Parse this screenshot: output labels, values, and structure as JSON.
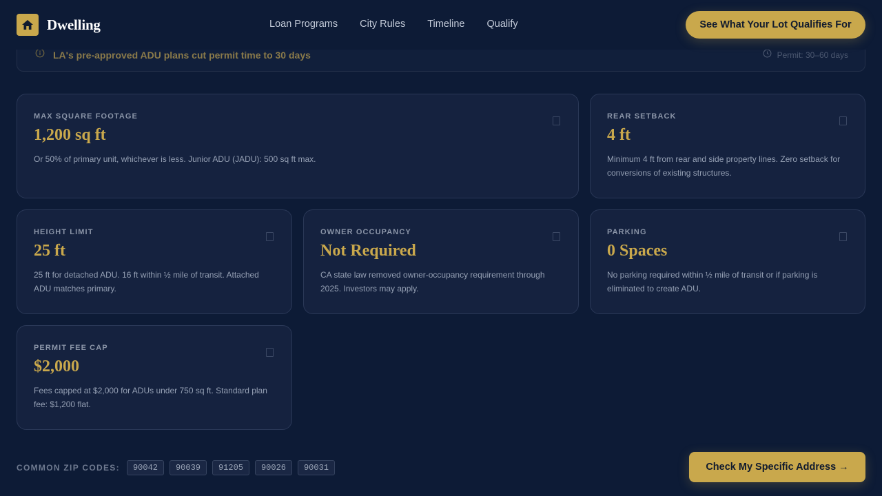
{
  "brand": {
    "name": "Dwelling",
    "logo_icon": "house-icon",
    "accent": "#c9a84c"
  },
  "nav": {
    "items": [
      {
        "label": "Loan Programs"
      },
      {
        "label": "City Rules"
      },
      {
        "label": "Timeline"
      },
      {
        "label": "Qualify"
      }
    ],
    "cta": "See What Your Lot Qualifies For"
  },
  "notice": {
    "text": "LA's pre-approved ADU plans cut permit time to 30 days",
    "permit": "Permit: 30–60 days"
  },
  "cards": [
    {
      "label": "MAX SQUARE FOOTAGE",
      "value": "1,200 sq ft",
      "desc": "Or 50% of primary unit, whichever is less. Junior ADU (JADU): 500 sq ft max."
    },
    {
      "label": "REAR SETBACK",
      "value": "4 ft",
      "desc": "Minimum 4 ft from rear and side property lines. Zero setback for conversions of existing structures."
    },
    {
      "label": "HEIGHT LIMIT",
      "value": "25 ft",
      "desc": "25 ft for detached ADU. 16 ft within ½ mile of transit. Attached ADU matches primary."
    },
    {
      "label": "OWNER OCCUPANCY",
      "value": "Not Required",
      "desc": "CA state law removed owner-occupancy requirement through 2025. Investors may apply."
    },
    {
      "label": "PARKING",
      "value": "0 Spaces",
      "desc": "No parking required within ½ mile of transit or if parking is eliminated to create ADU."
    },
    {
      "label": "PERMIT FEE CAP",
      "value": "$2,000",
      "desc": "Fees capped at $2,000 for ADUs under 750 sq ft. Standard plan fee: $1,200 flat."
    }
  ],
  "footer": {
    "zip_label": "COMMON ZIP CODES:",
    "zips": [
      "90042",
      "90039",
      "91205",
      "90026",
      "90031"
    ],
    "cta": "Check My Specific Address →"
  }
}
